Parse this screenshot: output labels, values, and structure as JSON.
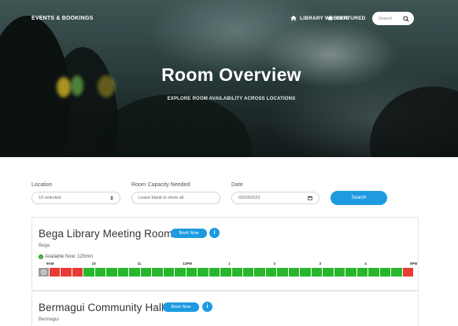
{
  "nav": {
    "brand": "EVENTS & BOOKINGS",
    "library_website": "LIBRARY WEBSITE",
    "featured": "FEATURED",
    "search_placeholder": "Search"
  },
  "hero": {
    "title": "Room Overview",
    "subtitle": "EXPLORE ROOM AVAILABILITY ACROSS LOCATIONS"
  },
  "filters": {
    "location_label": "Location",
    "location_value": "10 selected",
    "capacity_label": "Room Capacity Needed",
    "capacity_placeholder": "Leave blank to show all",
    "date_label": "Date",
    "date_value": "03/03/2023",
    "search_button": "Search"
  },
  "rooms": [
    {
      "name": "Bega Library Meeting Room",
      "book_label": "Book Now",
      "info_label": "i",
      "location": "Bega",
      "availability": "Available Now: 120min",
      "time_labels": [
        "9AM",
        "10",
        "11",
        "12PM",
        "1",
        "2",
        "3",
        "4",
        "5PM"
      ],
      "slots": [
        "booked",
        "booked",
        "booked",
        "free",
        "free",
        "free",
        "free",
        "free",
        "free",
        "free",
        "free",
        "free",
        "free",
        "free",
        "free",
        "free",
        "free",
        "free",
        "free",
        "free",
        "free",
        "free",
        "free",
        "free",
        "free",
        "free",
        "free",
        "free",
        "free",
        "free",
        "free",
        "booked"
      ]
    },
    {
      "name": "Bermagui Community Hall",
      "book_label": "Book Now",
      "info_label": "i",
      "location": "Bermagui"
    }
  ],
  "colors": {
    "accent": "#1e9be0",
    "available": "#28b62c",
    "booked": "#e63b36"
  }
}
